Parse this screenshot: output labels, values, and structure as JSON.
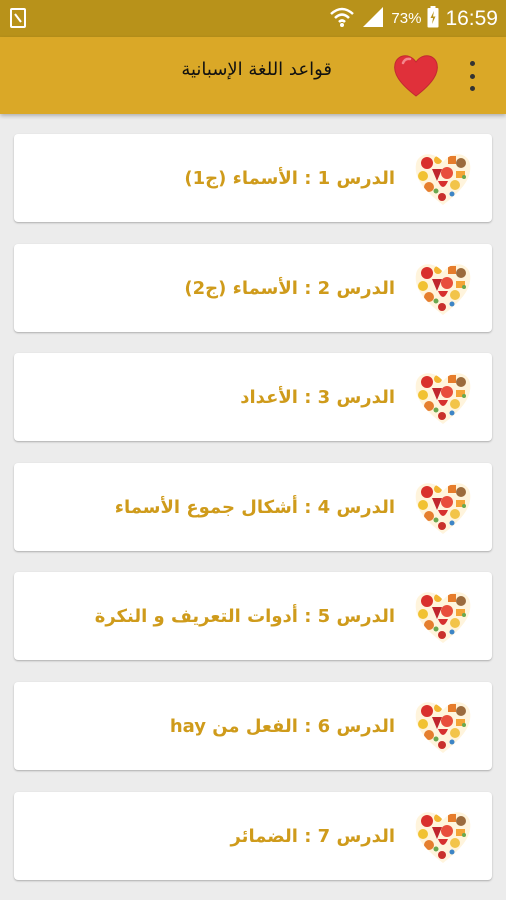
{
  "status_bar": {
    "battery_percent": "73%",
    "time": "16:59"
  },
  "app_bar": {
    "title": "قواعد اللغة الإسبانية"
  },
  "lessons": [
    {
      "label": "الدرس 1 : الأسماء (ج1)"
    },
    {
      "label": "الدرس 2 : الأسماء (ج2)"
    },
    {
      "label": "الدرس 3 : الأعداد"
    },
    {
      "label": "الدرس 4 : أشكال جموع الأسماء"
    },
    {
      "label": "الدرس 5 : أدوات التعريف و النكرة"
    },
    {
      "label": "الدرس 6 : الفعل من hay"
    },
    {
      "label": "الدرس 7 : الضمائر"
    }
  ],
  "colors": {
    "status_bar": "#b8921a",
    "app_bar": "#daa827",
    "label_text": "#cf9b1b",
    "heart": "#e0303a"
  }
}
